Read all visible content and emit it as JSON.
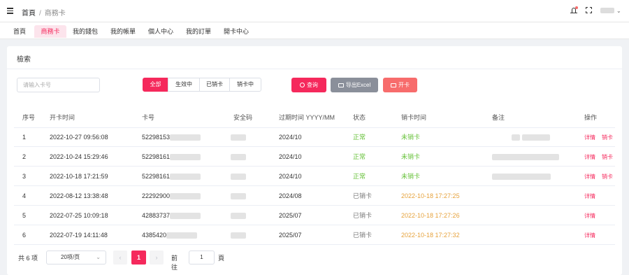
{
  "breadcrumb": {
    "home": "首頁",
    "separator": "/",
    "current": "商務卡"
  },
  "tabs": [
    {
      "label": "首頁"
    },
    {
      "label": "商務卡"
    },
    {
      "label": "我的錢包"
    },
    {
      "label": "我的帳單"
    },
    {
      "label": "個人中心"
    },
    {
      "label": "我的訂單"
    },
    {
      "label": "開卡中心"
    }
  ],
  "panel": {
    "title": "檢索"
  },
  "search": {
    "placeholder": "请输入卡号",
    "value": ""
  },
  "filters": [
    {
      "label": "全部",
      "active": true
    },
    {
      "label": "生效中",
      "active": false
    },
    {
      "label": "已销卡",
      "active": false
    },
    {
      "label": "销卡中",
      "active": false
    }
  ],
  "actions": {
    "query": "查询",
    "export": "导出Excel",
    "open": "开卡"
  },
  "table": {
    "headers": [
      "序号",
      "开卡时间",
      "卡号",
      "安全码",
      "过期时间 YYYY/MM",
      "状态",
      "销卡时间",
      "备注",
      "操作"
    ],
    "rows": [
      {
        "no": "1",
        "open_time": "2022-10-27 09:56:08",
        "card": "52298153",
        "expire": "2024/10",
        "status": "正常",
        "cancel": "未销卡",
        "ops": [
          "详情",
          "销卡"
        ]
      },
      {
        "no": "2",
        "open_time": "2022-10-24 15:29:46",
        "card": "52298161",
        "expire": "2024/10",
        "status": "正常",
        "cancel": "未销卡",
        "ops": [
          "详情",
          "销卡"
        ]
      },
      {
        "no": "3",
        "open_time": "2022-10-18 17:21:59",
        "card": "52298161",
        "expire": "2024/10",
        "status": "正常",
        "cancel": "未销卡",
        "ops": [
          "详情",
          "销卡"
        ]
      },
      {
        "no": "4",
        "open_time": "2022-08-12 13:38:48",
        "card": "22292900",
        "expire": "2024/08",
        "status": "已销卡",
        "cancel": "2022-10-18 17:27:25",
        "ops": [
          "详情"
        ]
      },
      {
        "no": "5",
        "open_time": "2022-07-25 10:09:18",
        "card": "42883737",
        "expire": "2025/07",
        "status": "已销卡",
        "cancel": "2022-10-18 17:27:26",
        "ops": [
          "详情"
        ]
      },
      {
        "no": "6",
        "open_time": "2022-07-19 14:11:48",
        "card": "4385420",
        "expire": "2025/07",
        "status": "已销卡",
        "cancel": "2022-10-18 17:27:32",
        "ops": [
          "详情"
        ]
      }
    ]
  },
  "pagination": {
    "total_label": "共 6 项",
    "page_size": "20项/页",
    "current_page": "1",
    "goto_label": "前往",
    "goto_value": "1",
    "page_unit": "頁"
  },
  "colors": {
    "primary": "#f5295c",
    "normal": "#67c23a",
    "cancel_time": "#e6a23c",
    "export": "#8a8f9a",
    "open": "#f76c6c"
  }
}
